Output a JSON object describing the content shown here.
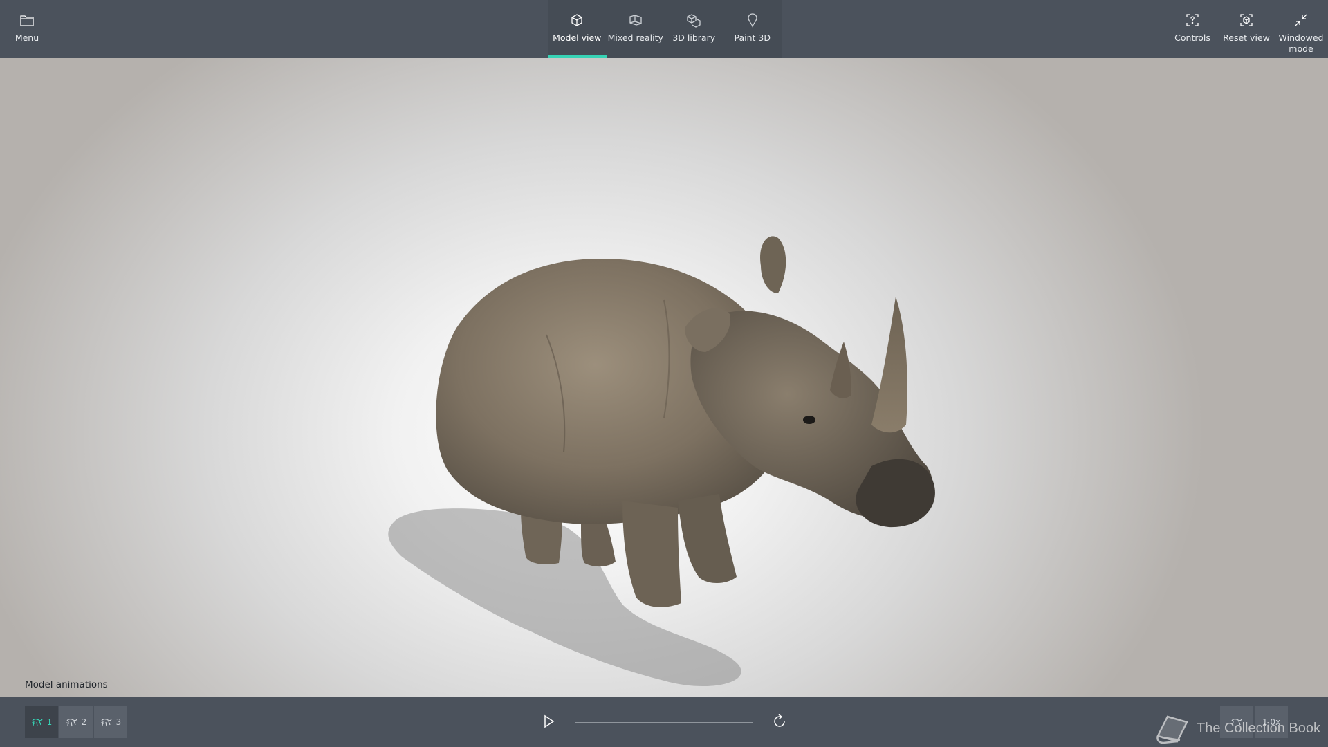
{
  "topbar": {
    "menu_label": "Menu",
    "tabs": [
      {
        "label": "Model view",
        "active": true
      },
      {
        "label": "Mixed reality",
        "active": false
      },
      {
        "label": "3D library",
        "active": false
      },
      {
        "label": "Paint 3D",
        "active": false
      }
    ],
    "controls_label": "Controls",
    "reset_view_label": "Reset view",
    "windowed_mode_label": "Windowed mode"
  },
  "viewport": {
    "model_label": "Model animations"
  },
  "bottombar": {
    "animations": [
      {
        "label": "1",
        "active": true
      },
      {
        "label": "2",
        "active": false
      },
      {
        "label": "3",
        "active": false
      }
    ],
    "playback_progress": 0.0,
    "speed_label": "1.0x"
  },
  "watermark": {
    "text": "The Collection Book"
  },
  "colors": {
    "accent": "#37d3b5",
    "bar": "#4b525c"
  }
}
